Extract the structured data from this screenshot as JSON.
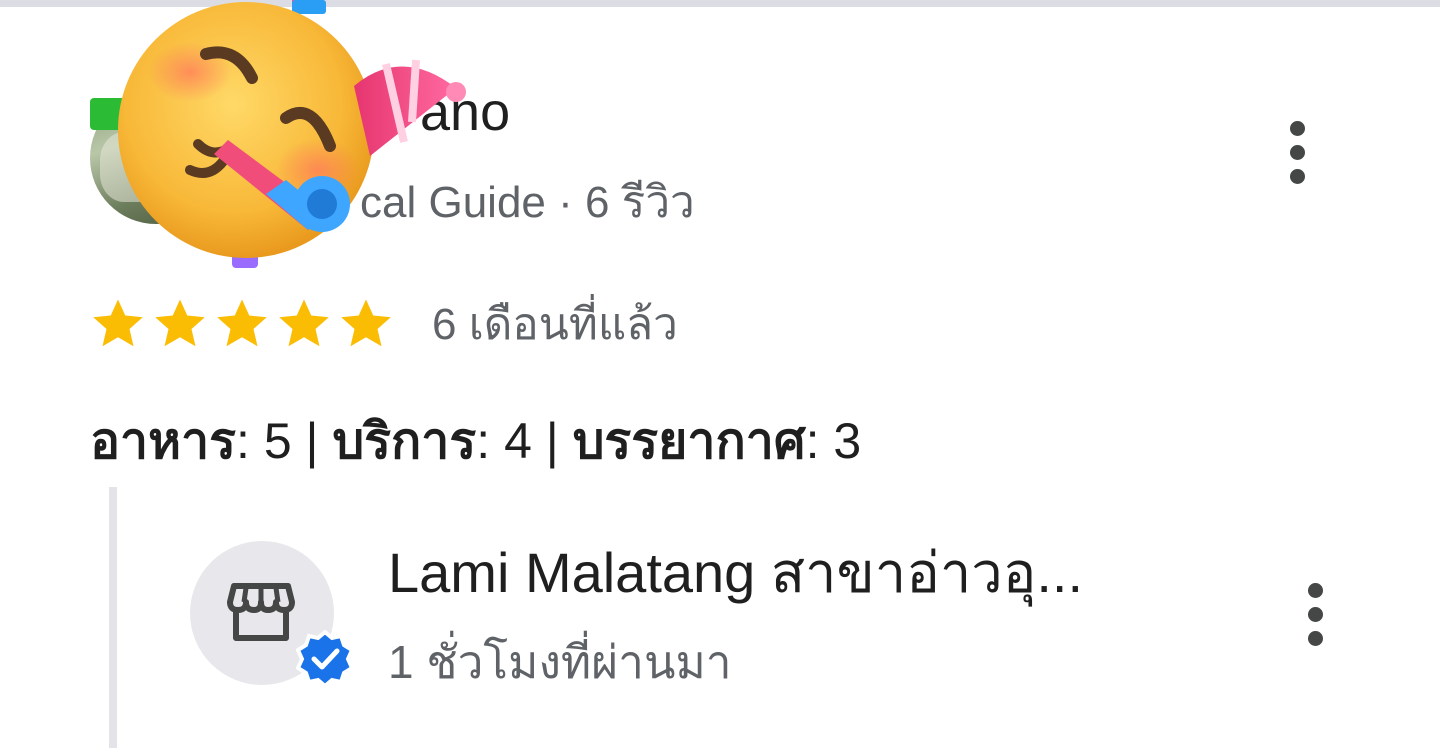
{
  "reviewer": {
    "name_visible": "ano",
    "meta": "cal Guide · 6 รีวิว"
  },
  "review": {
    "rating": 5,
    "rating_max": 5,
    "date": "6 เดือนที่แล้ว",
    "aspects": [
      {
        "label": "อาหาร",
        "value": "5"
      },
      {
        "label": "บริการ",
        "value": "4"
      },
      {
        "label": "บรรยากาศ",
        "value": "3"
      }
    ],
    "separator": ":",
    "divider": "|"
  },
  "owner_reply": {
    "name": "Lami Malatang สาขาอ่าวอุ...",
    "time": "1 ชั่วโมงที่ผ่านมา"
  },
  "icons": {
    "more": "more-vert-icon",
    "star": "star-icon",
    "store": "store-icon",
    "verified": "verified-badge-icon",
    "overlay": "party-face-emoji"
  },
  "colors": {
    "star": "#fbbc04",
    "verified": "#1a73e8",
    "text_primary": "#1f1f1f",
    "text_secondary": "#5f6368",
    "reply_border": "#e3e3e8"
  }
}
